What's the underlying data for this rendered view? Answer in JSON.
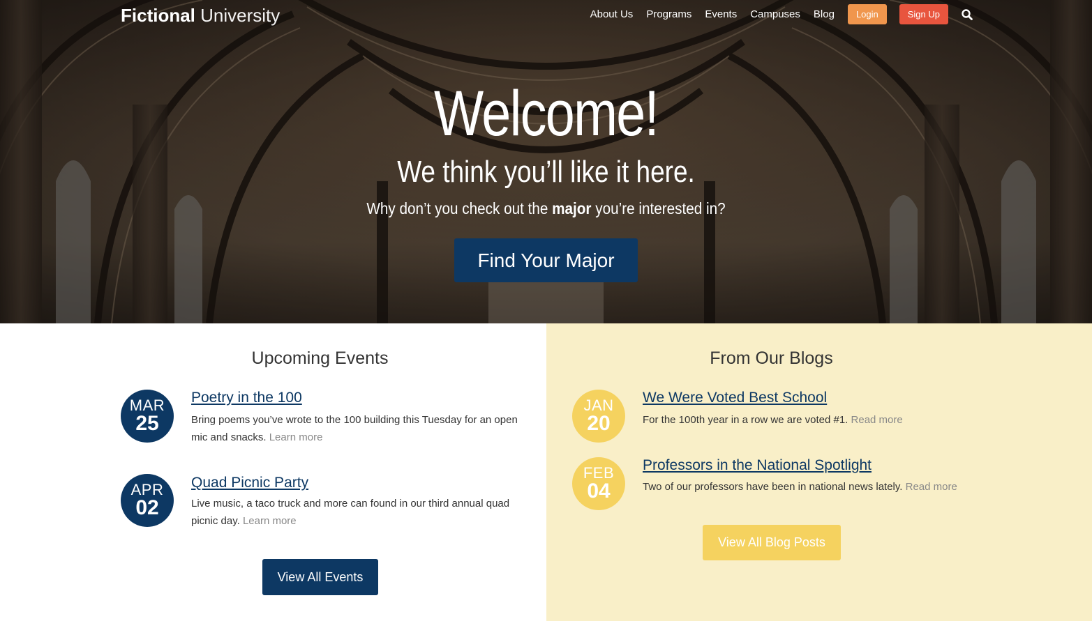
{
  "header": {
    "logo_strong": "Fictional",
    "logo_light": "University",
    "nav": [
      {
        "label": "About Us"
      },
      {
        "label": "Programs"
      },
      {
        "label": "Events"
      },
      {
        "label": "Campuses"
      },
      {
        "label": "Blog"
      }
    ],
    "login_label": "Login",
    "signup_label": "Sign Up",
    "search_icon": "search-icon"
  },
  "hero": {
    "title": "Welcome!",
    "subtitle": "We think you’ll like it here.",
    "text_before": "Why don’t you check out the ",
    "text_bold": "major",
    "text_after": " you’re interested in?",
    "button_label": "Find Your Major"
  },
  "events": {
    "heading": "Upcoming Events",
    "items": [
      {
        "month": "MAR",
        "day": "25",
        "title": "Poetry in the 100",
        "desc": "Bring poems you’ve wrote to the 100 building this Tuesday for an open mic and snacks.",
        "link": "Learn more"
      },
      {
        "month": "APR",
        "day": "02",
        "title": "Quad Picnic Party",
        "desc": "Live music, a taco truck and more can found in our third annual quad picnic day.",
        "link": "Learn more"
      }
    ],
    "button_label": "View All Events"
  },
  "blogs": {
    "heading": "From Our Blogs",
    "items": [
      {
        "month": "JAN",
        "day": "20",
        "title": "We Were Voted Best School",
        "desc": "For the 100th year in a row we are voted #1.",
        "link": "Read more"
      },
      {
        "month": "FEB",
        "day": "04",
        "title": "Professors in the National Spotlight",
        "desc": "Two of our professors have been in national news lately.",
        "link": "Read more"
      }
    ],
    "button_label": "View All Blog Posts"
  },
  "colors": {
    "navy": "#0d3863",
    "yellow": "#f5d25f",
    "cream": "#f9efc8",
    "login_orange": "#f0964d",
    "signup_red": "#e8553e"
  }
}
